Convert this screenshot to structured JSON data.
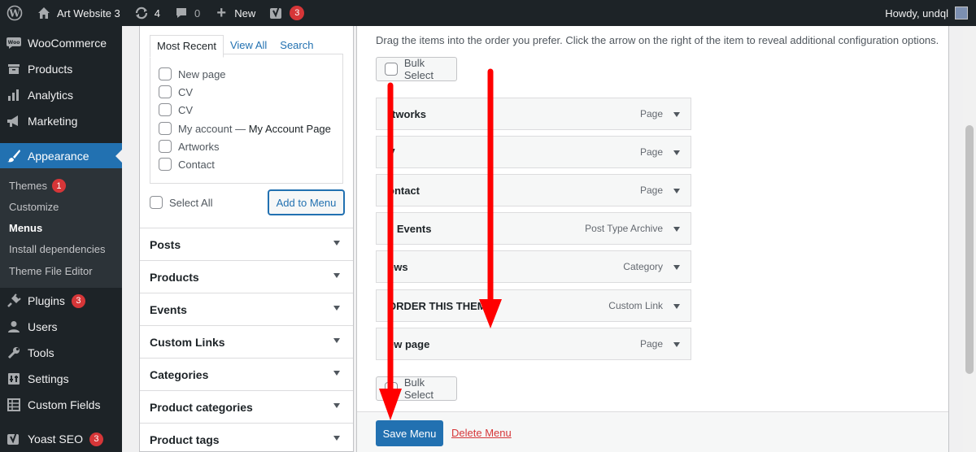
{
  "adminbar": {
    "site_name": "Art Website 3",
    "updates_count": "4",
    "comments_count": "0",
    "new_label": "New",
    "yoast_count": "3",
    "howdy": "Howdy, undql"
  },
  "sidebar": {
    "woocommerce": "WooCommerce",
    "products": "Products",
    "analytics": "Analytics",
    "marketing": "Marketing",
    "appearance": "Appearance",
    "sub": {
      "themes": "Themes",
      "themes_count": "1",
      "customize": "Customize",
      "menus": "Menus",
      "install": "Install dependencies",
      "editor": "Theme File Editor"
    },
    "plugins": "Plugins",
    "plugins_count": "3",
    "users": "Users",
    "tools": "Tools",
    "settings": "Settings",
    "custom_fields": "Custom Fields",
    "yoast": "Yoast SEO",
    "yoast_count": "3"
  },
  "pages_box": {
    "tabs": [
      "Most Recent",
      "View All",
      "Search"
    ],
    "items": [
      "New page",
      "CV",
      "CV",
      "My account",
      "Artworks",
      "Contact"
    ],
    "my_account_dash": " — ",
    "my_account_suffix": "My Account Page",
    "select_all": "Select All",
    "add_to_menu": "Add to Menu"
  },
  "accordion": [
    "Posts",
    "Products",
    "Events",
    "Custom Links",
    "Categories",
    "Product categories",
    "Product tags"
  ],
  "menu_structure": {
    "instructions": "Drag the items into the order you prefer. Click the arrow on the right of the item to reveal additional configuration options.",
    "bulk_select": "Bulk Select",
    "items": [
      {
        "title": "rtworks",
        "kind": "Page"
      },
      {
        "title": "V",
        "kind": "Page"
      },
      {
        "title": "ontact",
        "kind": "Page"
      },
      {
        "title": "ll Events",
        "kind": "Post Type Archive"
      },
      {
        "title": "ews",
        "kind": "Category"
      },
      {
        "title": "ORDER THIS THEMA",
        "kind": "Custom Link"
      },
      {
        "title": "ew page",
        "kind": "Page"
      }
    ],
    "save": "Save Menu",
    "delete": "Delete Menu"
  },
  "colors": {
    "admin_dark": "#1d2327",
    "accent": "#2271b1",
    "danger": "#d63638",
    "annotation_arrow": "#ff0000"
  }
}
